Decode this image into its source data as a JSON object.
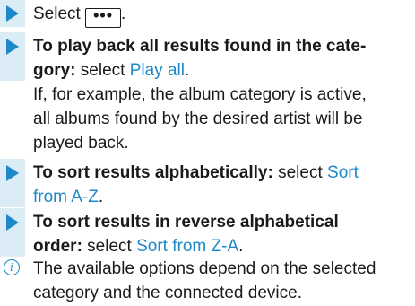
{
  "steps": [
    {
      "prefix": "Select ",
      "button": "•••",
      "suffix": "."
    },
    {
      "bold": "To play back all results found in the cate-",
      "bold2": "gory:",
      "text": " select ",
      "link": "Play all",
      "tail": ".",
      "note": [
        "If, for example, the album category is active,",
        "all albums found by the desired artist will be",
        "played back."
      ]
    },
    {
      "bold": "To sort results alphabetically:",
      "text": " select ",
      "link": "Sort",
      "link2": "from A-Z",
      "tail": "."
    },
    {
      "bold": "To sort results in reverse alphabetical",
      "bold2": "order:",
      "text": " select ",
      "link": "Sort from Z-A",
      "tail": "."
    }
  ],
  "info": {
    "icon": "info-icon",
    "lines": [
      "The available options depend on the selected",
      "category and the connected device."
    ]
  },
  "colors": {
    "accent": "#1e88c8",
    "step_bar": "#dcecf7"
  }
}
